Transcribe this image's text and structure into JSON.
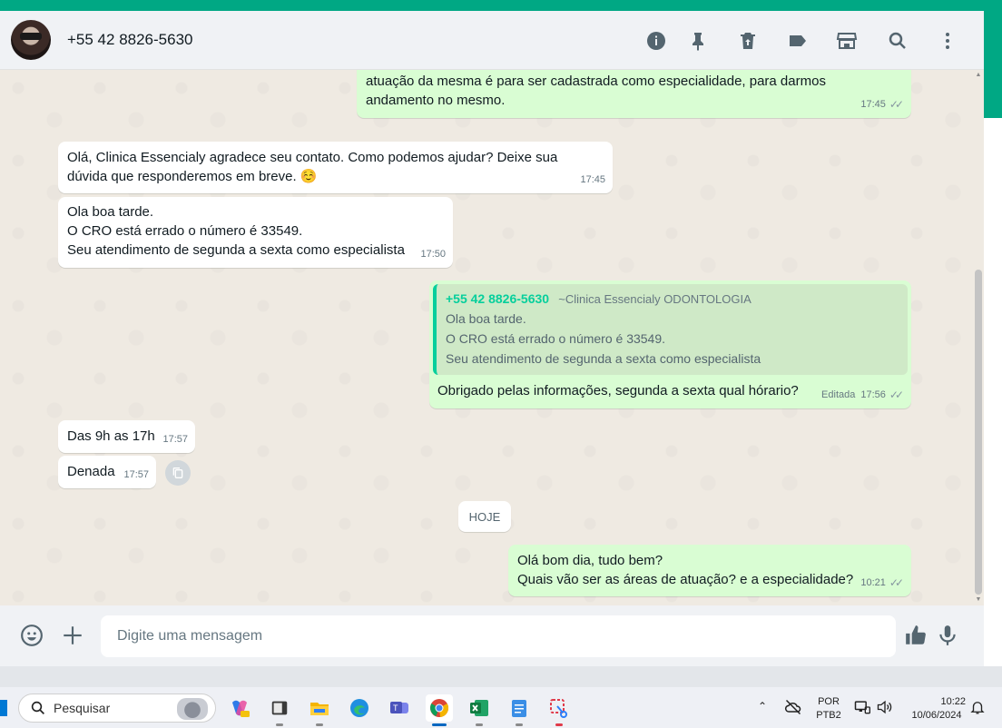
{
  "header": {
    "contact_name": "+55 42 8826-5630",
    "icons": [
      "info-icon",
      "pin-icon",
      "delete-icon",
      "label-icon",
      "store-icon",
      "search-icon",
      "menu-icon"
    ]
  },
  "messages": {
    "m1": {
      "lines": [
        "atuação da mesma é para ser cadastrada como especialidade, para darmos",
        "andamento no mesmo."
      ],
      "time": "17:45",
      "ticks": "✓✓"
    },
    "m2": {
      "lines": [
        "Olá, Clinica Essencialy agradece seu contato. Como podemos ajudar? Deixe sua",
        "dúvida que responderemos em breve. ☺️"
      ],
      "time": "17:45"
    },
    "m3": {
      "lines": [
        "Ola boa tarde.",
        "O CRO está errado o número é 33549.",
        "Seu atendimento de segunda a sexta como especialista"
      ],
      "time": "17:50"
    },
    "m4": {
      "quote_author": "+55 42 8826-5630",
      "quote_sub": "~Clinica Essencialy ODONTOLOGIA",
      "quote_lines": [
        "Ola boa tarde.",
        "O CRO está errado o número é 33549.",
        "Seu atendimento de segunda a sexta como especialista"
      ],
      "text": "Obrigado pelas informações, segunda a sexta qual hórario?",
      "edited": "Editada",
      "time": "17:56",
      "ticks": "✓✓"
    },
    "m5": {
      "text": "Das 9h as 17h",
      "time": "17:57"
    },
    "m6": {
      "text": "Denada",
      "time": "17:57"
    },
    "date_chip": "HOJE",
    "m7": {
      "lines": [
        "Olá bom dia, tudo bem?",
        "Quais vão ser as áreas de atuação? e a especialidade?"
      ],
      "time": "10:21",
      "ticks": "✓✓"
    }
  },
  "composer": {
    "placeholder": "Digite uma mensagem",
    "icons": [
      "emoji-icon",
      "plus-icon",
      "thumbs-up-icon",
      "microphone-icon"
    ]
  },
  "taskbar": {
    "search_placeholder": "Pesquisar",
    "lang_top": "POR",
    "lang_bottom": "PTB2",
    "time": "10:22",
    "date": "10/06/2024"
  },
  "colors": {
    "accent": "#00a884",
    "outgoing": "#d9fdd3",
    "incoming": "#ffffff",
    "chat_bg": "#efeae2"
  }
}
